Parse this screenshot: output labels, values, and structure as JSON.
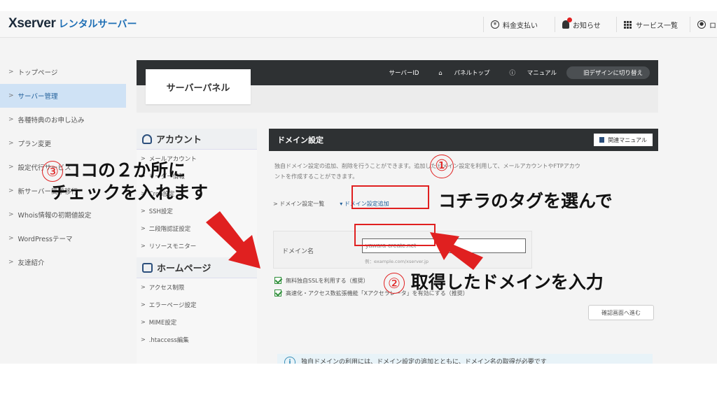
{
  "header": {
    "logo_main": "Xserver",
    "logo_sub": "レンタルサーバー",
    "nav": [
      {
        "label": "料金支払い"
      },
      {
        "label": "お知らせ"
      },
      {
        "label": "サービス一覧"
      },
      {
        "label": "ロ"
      }
    ]
  },
  "sidebar": {
    "items": [
      {
        "label": "トップページ"
      },
      {
        "label": "サーバー管理"
      },
      {
        "label": "各種特典のお申し込み"
      },
      {
        "label": "プラン変更"
      },
      {
        "label": "設定代行サービス"
      },
      {
        "label": "新サーバー簡単移行"
      },
      {
        "label": "Whois情報の初期値設定"
      },
      {
        "label": "WordPressテーマ"
      },
      {
        "label": "友達紹介"
      }
    ]
  },
  "panel": {
    "tab_label": "サーバーパネル",
    "server_id": "サーバーID",
    "links": [
      "パネルトップ",
      "マニュアル"
    ],
    "old_design": "旧デザインに切り替え"
  },
  "panel_menu": {
    "account_title": "アカウント",
    "account_items": [
      "メールアカウント",
      "リーダー情報",
      "Cron設定",
      "SSH設定",
      "二段階認証設定",
      "リソースモニター"
    ],
    "homepage_title": "ホームページ",
    "homepage_items": [
      "アクセス制限",
      "エラーページ設定",
      "MIME設定",
      ".htaccess編集"
    ]
  },
  "domain": {
    "title": "ドメイン設定",
    "manual_btn": "関連マニュアル",
    "desc_line1": "独自ドメイン設定の追加、削除を行うことができます。追加したドメイン設定を利用して、メールアカウントやFTPアカウ",
    "desc_line2": "ントを作成することができます。",
    "tab_list": "ドメイン設定一覧",
    "tab_add": "ドメイン設定追加",
    "field_label": "ドメイン名",
    "field_value": "yawara-create.net",
    "field_hint": "例：example.com/xserver.jp",
    "check1": "無料独自SSLを利用する（推奨）",
    "check2": "高速化・アクセス数拡張機能「Xアクセラレータ」を有効にする（推奨）",
    "confirm_btn": "確認画面へ進む",
    "info": "独自ドメインの利用には、ドメイン設定の追加とともに、ドメイン名の取得が必要です"
  },
  "annotations": {
    "num1": "①",
    "num2": "②",
    "num3": "③",
    "tag_text": "コチラのタグを選んで",
    "input_text": "取得したドメインを入力",
    "check_line1": "ココの２か所に",
    "check_line2": "チェックを入れます"
  },
  "colors": {
    "accent_red": "#e02020",
    "dark_bar": "#2e3133",
    "active_blue": "#cfe2f5"
  }
}
